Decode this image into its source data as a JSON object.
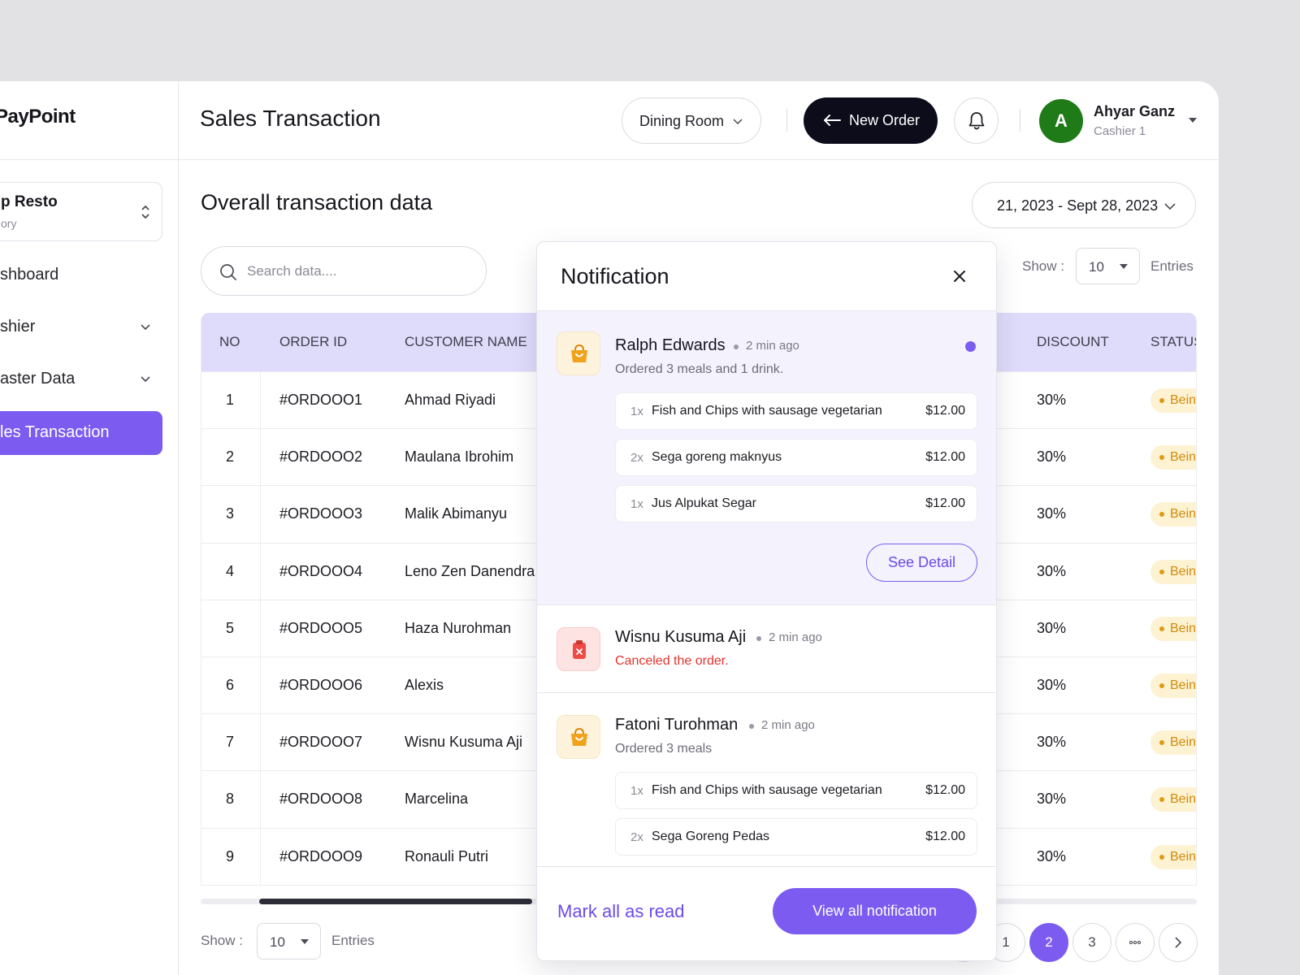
{
  "app": {
    "brand": "PayPoint"
  },
  "sidebar": {
    "store": {
      "name": "p Resto",
      "sub": "ory"
    },
    "items": [
      {
        "label": "shboard",
        "has_chevron": false,
        "active": false
      },
      {
        "label": "shier",
        "has_chevron": true,
        "active": false
      },
      {
        "label": "aster Data",
        "has_chevron": true,
        "active": false
      },
      {
        "label": "les Transaction",
        "has_chevron": false,
        "active": true
      }
    ]
  },
  "header": {
    "title": "Sales Transaction",
    "dining_label": "Dining Room",
    "new_order_label": "New Order",
    "user": {
      "initial": "A",
      "name": "Ahyar Ganz",
      "role": "Cashier 1",
      "avatar_color": "#1f7a18"
    }
  },
  "main": {
    "section_title": "Overall transaction data",
    "search_placeholder": "Search data....",
    "date_range": "21, 2023 - Sept 28, 2023",
    "show_label": "Show :",
    "show_value": "10",
    "entries_label": "Entries"
  },
  "table": {
    "columns": [
      "NO",
      "ORDER ID",
      "CUSTOMER NAME",
      "DISCOUNT",
      "STATUS"
    ],
    "rows": [
      {
        "no": "1",
        "order_id": "#ORDOOO1",
        "customer": "Ahmad Riyadi",
        "discount": "30%",
        "status": "Being"
      },
      {
        "no": "2",
        "order_id": "#ORDOOO2",
        "customer": "Maulana Ibrohim",
        "discount": "30%",
        "status": "Being"
      },
      {
        "no": "3",
        "order_id": "#ORDOOO3",
        "customer": "Malik Abimanyu",
        "discount": "30%",
        "status": "Being"
      },
      {
        "no": "4",
        "order_id": "#ORDOOO4",
        "customer": "Leno Zen Danendra",
        "discount": "30%",
        "status": "Being"
      },
      {
        "no": "5",
        "order_id": "#ORDOOO5",
        "customer": "Haza Nurohman",
        "discount": "30%",
        "status": "Being"
      },
      {
        "no": "6",
        "order_id": "#ORDOOO6",
        "customer": "Alexis",
        "discount": "30%",
        "status": "Being"
      },
      {
        "no": "7",
        "order_id": "#ORDOOO7",
        "customer": "Wisnu Kusuma Aji",
        "discount": "30%",
        "status": "Being"
      },
      {
        "no": "8",
        "order_id": "#ORDOOO8",
        "customer": "Marcelina",
        "discount": "30%",
        "status": "Being"
      },
      {
        "no": "9",
        "order_id": "#ORDOOO9",
        "customer": "Ronauli Putri",
        "discount": "30%",
        "status": "Being"
      }
    ]
  },
  "footer": {
    "show_label": "Show :",
    "show_value": "10",
    "entries_label": "Entries",
    "pages": [
      "1",
      "2",
      "3"
    ],
    "current_page": "2"
  },
  "notification": {
    "title": "Notification",
    "items": [
      {
        "name": "Ralph Edwards",
        "time": "2 min ago",
        "message": "Ordered 3 meals and 1 drink.",
        "icon": "shopping-bag-icon",
        "unread": true,
        "lines": [
          {
            "qty": "1x",
            "name": "Fish and Chips with sausage vegetarian",
            "price": "$12.00"
          },
          {
            "qty": "2x",
            "name": "Sega goreng maknyus",
            "price": "$12.00"
          },
          {
            "qty": "1x",
            "name": "Jus Alpukat Segar",
            "price": "$12.00"
          }
        ],
        "action": "See Detail"
      },
      {
        "name": "Wisnu Kusuma Aji",
        "time": "2 min ago",
        "message": "Canceled the order.",
        "icon": "cancel-order-icon",
        "unread": false,
        "lines": []
      },
      {
        "name": "Fatoni Turohman",
        "time": "2 min ago",
        "message": "Ordered 3 meals",
        "icon": "shopping-bag-icon",
        "unread": false,
        "lines": [
          {
            "qty": "1x",
            "name": "Fish and Chips with sausage vegetarian",
            "price": "$12.00"
          },
          {
            "qty": "2x",
            "name": "Sega Goreng Pedas",
            "price": "$12.00"
          }
        ]
      }
    ],
    "mark_all_label": "Mark all as read",
    "view_all_label": "View all notification"
  },
  "colors": {
    "accent": "#7c5cf0",
    "dark": "#0c0c1a",
    "status_bg": "#fdf2d2",
    "status_text": "#d38a08",
    "cancel_text": "#e5322d"
  }
}
